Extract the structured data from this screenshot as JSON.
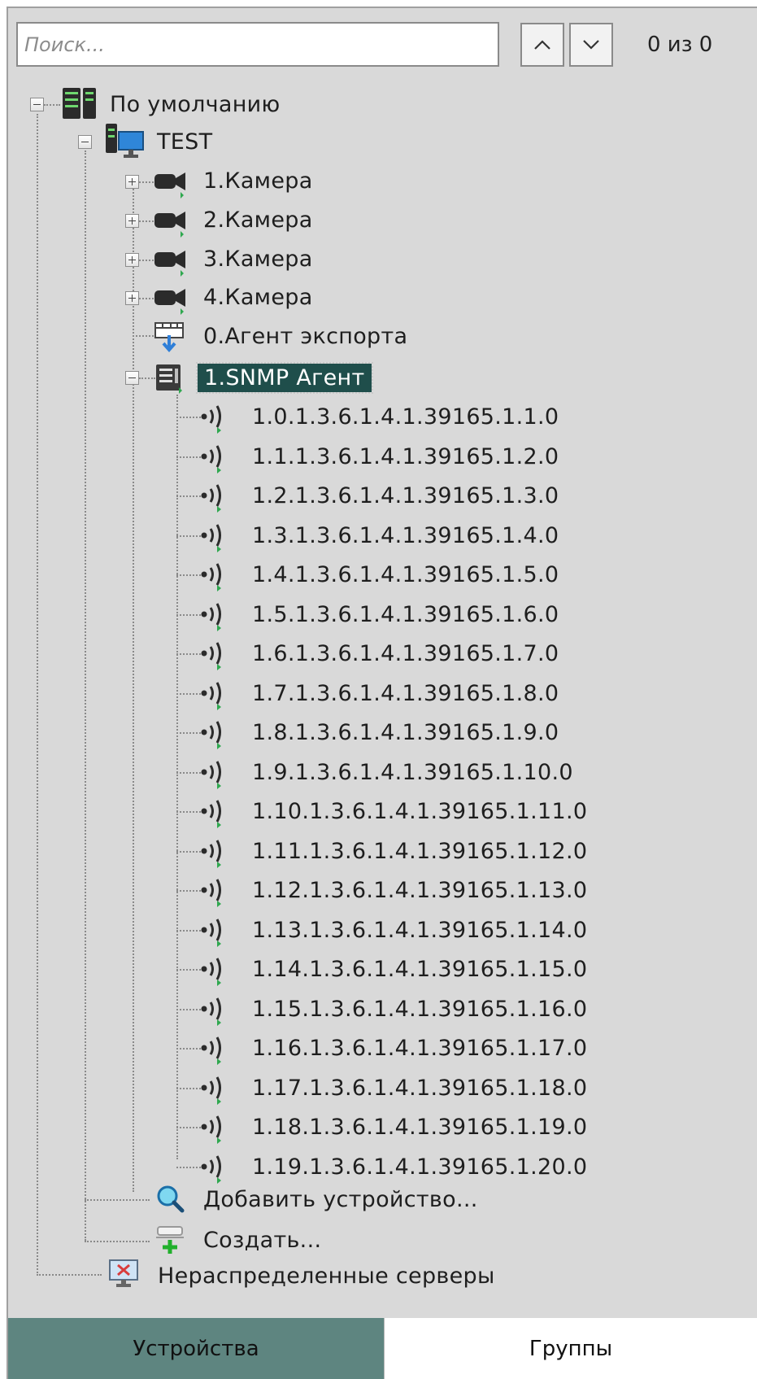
{
  "search": {
    "placeholder": "Поиск...",
    "value": "",
    "counter": "0 из 0"
  },
  "tree": {
    "root": "По умолчанию",
    "server": "TEST",
    "cameras": [
      "1.Камера",
      "2.Камера",
      "3.Камера",
      "4.Камера"
    ],
    "export_agent": "0.Агент экспорта",
    "snmp_agent": "1.SNMP Агент",
    "snmp_items": [
      "1.0.1.3.6.1.4.1.39165.1.1.0",
      "1.1.1.3.6.1.4.1.39165.1.2.0",
      "1.2.1.3.6.1.4.1.39165.1.3.0",
      "1.3.1.3.6.1.4.1.39165.1.4.0",
      "1.4.1.3.6.1.4.1.39165.1.5.0",
      "1.5.1.3.6.1.4.1.39165.1.6.0",
      "1.6.1.3.6.1.4.1.39165.1.7.0",
      "1.7.1.3.6.1.4.1.39165.1.8.0",
      "1.8.1.3.6.1.4.1.39165.1.9.0",
      "1.9.1.3.6.1.4.1.39165.1.10.0",
      "1.10.1.3.6.1.4.1.39165.1.11.0",
      "1.11.1.3.6.1.4.1.39165.1.12.0",
      "1.12.1.3.6.1.4.1.39165.1.13.0",
      "1.13.1.3.6.1.4.1.39165.1.14.0",
      "1.14.1.3.6.1.4.1.39165.1.15.0",
      "1.15.1.3.6.1.4.1.39165.1.16.0",
      "1.16.1.3.6.1.4.1.39165.1.17.0",
      "1.17.1.3.6.1.4.1.39165.1.18.0",
      "1.18.1.3.6.1.4.1.39165.1.19.0",
      "1.19.1.3.6.1.4.1.39165.1.20.0"
    ],
    "add_device": "Добавить устройство...",
    "create": "Создать...",
    "unassigned_servers": "Нераспределенные серверы"
  },
  "tabs": {
    "devices": "Устройства",
    "groups": "Группы"
  },
  "colors": {
    "selected_bg": "#1f4e4b",
    "active_tab": "#5e8580",
    "panel_bg": "#d9d9d9"
  },
  "icons": {
    "root": "server-rack-icon",
    "server": "server-monitor-icon",
    "camera": "camera-icon",
    "export": "export-agent-icon",
    "snmp": "snmp-agent-icon",
    "trap": "snmp-trap-icon",
    "search": "magnifier-icon",
    "create": "create-plus-icon",
    "unassigned": "unassigned-server-icon"
  }
}
